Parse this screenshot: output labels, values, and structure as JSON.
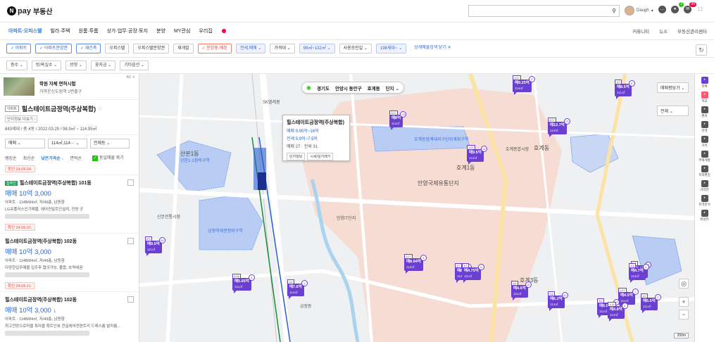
{
  "header": {
    "logo_mark": "N",
    "logo_pay": "pay",
    "logo_sub": "부동산",
    "search_placeholder": "",
    "user_name": "Daugh",
    "icons": [
      "chat-icon",
      "bell-icon",
      "mail-icon",
      "apps-icon"
    ],
    "bell_badge": "3",
    "mail_badge": "99"
  },
  "nav": {
    "items": [
      {
        "label": "아파트·오피스텔",
        "active": true
      },
      {
        "label": "빌라·주택",
        "active": false
      },
      {
        "label": "원룸·투룸",
        "active": false
      },
      {
        "label": "상가·업무·공장·토지",
        "active": false
      },
      {
        "label": "분양",
        "active": false
      },
      {
        "label": "MY관심",
        "active": false
      },
      {
        "label": "우리집",
        "active": false
      }
    ],
    "right": [
      "커뮤니티",
      "뉴스",
      "부동산관리센터"
    ]
  },
  "filters": [
    {
      "label": "✓ 아파트",
      "style": "blue"
    },
    {
      "label": "✓ 아파트분양권",
      "style": "blue"
    },
    {
      "label": "✓ 재건축",
      "style": "blue"
    },
    {
      "label": "오피스텔",
      "style": ""
    },
    {
      "label": "오피스텔분양권",
      "style": ""
    },
    {
      "label": "재개발",
      "style": ""
    },
    {
      "label": "✓ 분양중·예정",
      "style": "red"
    },
    {
      "label": "전세,매매 ⌄",
      "style": "fill"
    },
    {
      "label": "가격대 ⌄",
      "style": ""
    },
    {
      "label": "99㎡~132㎡ ⌄",
      "style": "fill"
    },
    {
      "label": "사용승인일 ⌄",
      "style": ""
    },
    {
      "label": "198세대~ ⌄",
      "style": "fill"
    },
    {
      "label": "상세매물검색 닫기 ✕",
      "style": "plain"
    }
  ],
  "sortbar": [
    "층수 ⌄",
    "방/욕실수 ⌄",
    "방향 ⌄",
    "융자금 ⌄",
    "기타옵션 ⌄"
  ],
  "ad": {
    "title": "학원 자체 면허시험",
    "sub": "가까운신도림역 1번출구",
    "tag": "AD ✕"
  },
  "detail": {
    "tag": "아파트",
    "title": "힐스테이트금정역(주상복합)",
    "link": "단지정보 더보기 ›",
    "meta": "843세대 / 총 4동 / 2022.03.25 / 98.9㎡ ~ 114.95㎡"
  },
  "selects": [
    "매매 ⌄",
    "114㎡,114··· ⌄",
    "전체동 ⌄"
  ],
  "sort": {
    "items": [
      "랭킹순",
      "최신순",
      "낮은가격순 ↓",
      "면적순"
    ],
    "active_index": 2,
    "same_merge": "동일매물 묶기"
  },
  "listings": [
    {
      "date": "확인 24.06.04.",
      "tag": "집주인",
      "name": "힐스테이트금정역(주상복합) 101동",
      "price": "매매 10억 3,000",
      "meta": "아파트 · 114B/84㎡, 저/49층, 남동향",
      "desc": "LG유플러스인기매물, 에어컨빌트인설치, 전망 굿"
    },
    {
      "date": "확인 24.06.07.",
      "tag": "",
      "name": "힐스테이트금정역(주상복합) 102동",
      "price": "매매 10억 3,000",
      "meta": "아파트 · 114B/84㎡, 저/49층, 남동향",
      "desc": "다양한입주매물 입주후 협의가능, 풀옵, 초역세권"
    },
    {
      "date": "확인 24.06.11.",
      "tag": "",
      "name": "힐스테이트금정역(주상복합) 102동",
      "price": "매매 10억 3,000 ↓",
      "meta": "아파트 · 114B/84㎡, 저/49층, 남동향",
      "desc": "최고전망으로마을 특마을 확트인뷰 전실에어컨편트리 드레스룸 발마름..."
    }
  ],
  "map": {
    "breadcrumb": [
      "경기도",
      "안양시 동안구",
      "호계동",
      "단지 ⌄"
    ],
    "popup": {
      "title": "힐스테이트금정역(주상복합)",
      "line1": "매매 9.95억~16억",
      "line2": "전세 5.9억~7.5억",
      "line3": "매매 27 · 전세 31",
      "btn1": "단지정보",
      "btn2": "시세/실거래가"
    },
    "labels": [
      {
        "text": "산본1동",
        "cls": "big"
      },
      {
        "text": "산본1-1정비구역",
        "cls": "blue"
      },
      {
        "text": "금정역세권정비구역",
        "cls": "blue"
      },
      {
        "text": "산본전통시장",
        "cls": ""
      },
      {
        "text": "호계동",
        "cls": "big"
      },
      {
        "text": "호계1동",
        "cls": "big"
      },
      {
        "text": "안양국제유통단지",
        "cls": "big"
      },
      {
        "text": "안양IT단지",
        "cls": ""
      },
      {
        "text": "호계동범계대지구단위계획구역",
        "cls": "blue"
      },
      {
        "text": "호계3동",
        "cls": "big"
      },
      {
        "text": "금정동",
        "cls": ""
      },
      {
        "text": "SK텔레콤",
        "cls": ""
      },
      {
        "text": "호계종합시장",
        "cls": ""
      }
    ],
    "markers": [
      {
        "top": "1/11",
        "price": "매8억",
        "sub": "114㎡",
        "count": "33"
      },
      {
        "top": "1/12",
        "price": "매9.25억",
        "sub": "114㎡",
        "count": "9"
      },
      {
        "top": "1/2",
        "price": "매8.5억",
        "sub": "111㎡",
        "count": "6"
      },
      {
        "top": "8/27",
        "price": "매12.7억",
        "sub": "114㎡",
        "count": "73"
      },
      {
        "top": "1/11",
        "price": "매9.5억",
        "sub": "114㎡",
        "count": "14"
      },
      {
        "top": "2/5",
        "price": "매9.5억",
        "sub": "111㎡",
        "count": "45"
      },
      {
        "top": "3/38",
        "price": "매5.95억",
        "sub": "111㎡",
        "count": "4"
      },
      {
        "top": "1/4",
        "price": "매7.6억",
        "sub": "114㎡",
        "count": "1"
      },
      {
        "top": "1/17",
        "price": "매8.94억",
        "sub": "114㎡",
        "count": "3"
      },
      {
        "top": "1/7",
        "price": "매8억",
        "sub": "114㎡",
        "count": "72"
      },
      {
        "top": "1/3",
        "price": "매4.75억",
        "sub": "111㎡",
        "count": "6"
      },
      {
        "top": "1/6",
        "price": "매4.6억",
        "sub": "111㎡",
        "count": "10"
      },
      {
        "top": "1/4",
        "price": "매6.2억",
        "sub": "114㎡",
        "count": "42"
      },
      {
        "top": "1/7",
        "price": "매5.1억",
        "sub": "114㎡",
        "count": "15"
      },
      {
        "top": "1/4",
        "price": "매4.7억",
        "sub": "114㎡",
        "count": "9"
      },
      {
        "top": "1/17",
        "price": "매4.5억",
        "sub": "111㎡",
        "count": "1"
      },
      {
        "top": "1/4",
        "price": "매6.05억",
        "sub": "111㎡",
        "count": "19"
      },
      {
        "top": "1/16",
        "price": "매4.8억",
        "sub": "114㎡",
        "count": "5"
      },
      {
        "top": "1/2",
        "price": "매5.5억",
        "sub": "111㎡",
        "count": "2"
      }
    ],
    "select_main": "매매평당가 ⌄",
    "select_sub": "전체 ⌄",
    "scale": "200m"
  },
  "toolbar": [
    {
      "label": "목록",
      "icon": "list-icon",
      "style": "purple"
    },
    {
      "label": "학교",
      "icon": "school-icon",
      "style": "pink"
    },
    {
      "label": "편의",
      "icon": "store-icon",
      "style": ""
    },
    {
      "label": "반경",
      "icon": "circle-icon",
      "style": ""
    },
    {
      "label": "거리",
      "icon": "ruler-icon",
      "style": ""
    },
    {
      "label": "주택개발",
      "icon": "develop-icon",
      "style": ""
    },
    {
      "label": "지적편집",
      "icon": "map-edit-icon",
      "style": ""
    },
    {
      "label": "거리뷰",
      "icon": "street-view-icon",
      "style": ""
    },
    {
      "label": "지역분석",
      "icon": "chart-icon",
      "style": ""
    },
    {
      "label": "위성뷰",
      "icon": "satellite-icon",
      "style": ""
    }
  ],
  "colors": {
    "accent_blue": "#2a7de1",
    "marker_purple": "#6a3fd1",
    "zone_blue": "#a8c4f2",
    "zone_pink": "#f7d7d0"
  }
}
